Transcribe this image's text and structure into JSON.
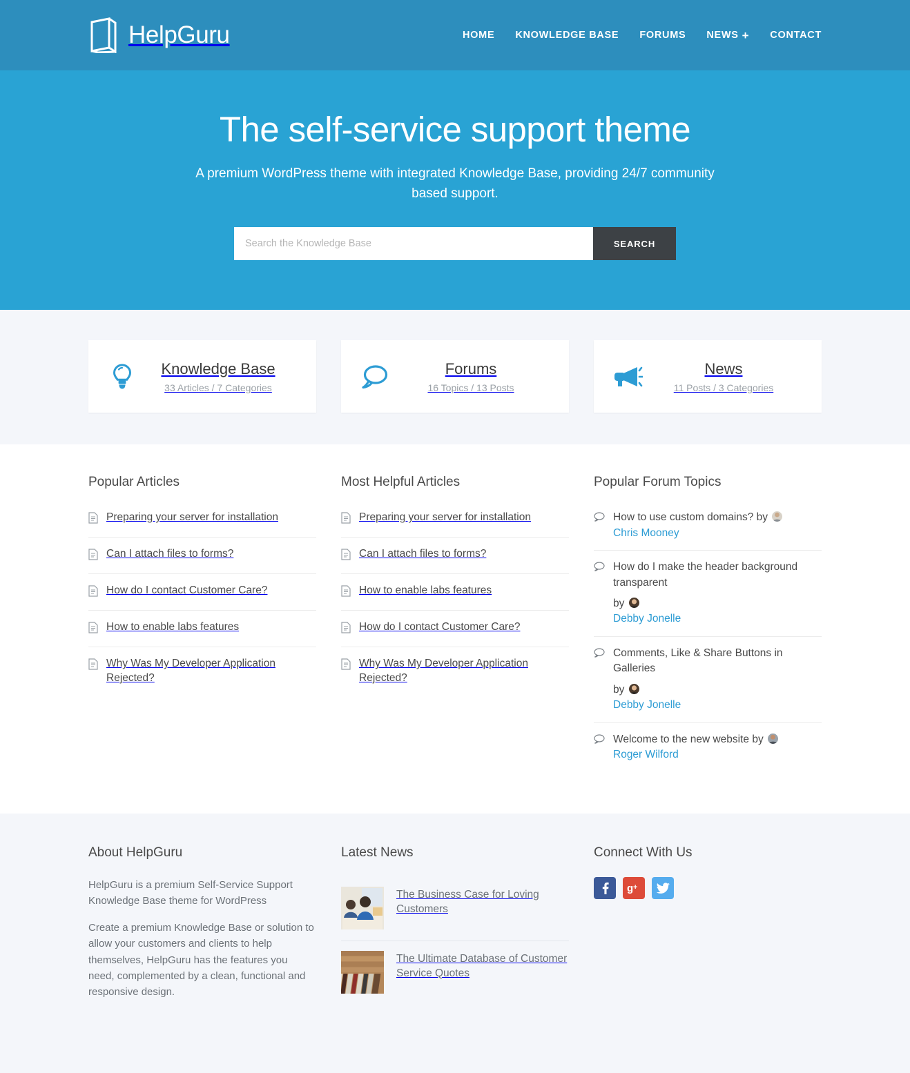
{
  "header": {
    "brand": "HelpGuru",
    "brand_icon": "book-icon",
    "bg_color": "#2d8ebd",
    "nav": [
      {
        "label": "HOME",
        "has_plus": false
      },
      {
        "label": "KNOWLEDGE BASE",
        "has_plus": false
      },
      {
        "label": "FORUMS",
        "has_plus": false
      },
      {
        "label": "NEWS",
        "has_plus": true,
        "plus": "+"
      },
      {
        "label": "CONTACT",
        "has_plus": false
      }
    ]
  },
  "hero": {
    "title": "The self-service support theme",
    "subtitle": "A premium WordPress theme with integrated Knowledge Base, providing 24/7 community based support.",
    "bg_color": "#29a3d4",
    "search": {
      "placeholder": "Search the Knowledge Base",
      "value": "",
      "button_label": "SEARCH",
      "button_color": "#3d4145"
    }
  },
  "cards": [
    {
      "icon": "lightbulb-icon",
      "title": "Knowledge Base",
      "meta": "33 Articles / 7 Categories"
    },
    {
      "icon": "speech-bubble-icon",
      "title": "Forums",
      "meta": "16 Topics / 13 Posts"
    },
    {
      "icon": "megaphone-icon",
      "title": "News",
      "meta": "11 Posts / 3 Categories"
    }
  ],
  "popular_articles": {
    "heading": "Popular Articles",
    "items": [
      "Preparing your server for installation",
      "Can I attach files to forms?",
      "How do I contact Customer Care?",
      "How to enable labs features",
      "Why Was My Developer Application Rejected?"
    ]
  },
  "most_helpful_articles": {
    "heading": "Most Helpful Articles",
    "items": [
      "Preparing your server for installation",
      "Can I attach files to forms?",
      "How to enable labs features",
      "How do I contact Customer Care?",
      "Why Was My Developer Application Rejected?"
    ]
  },
  "forum_topics": {
    "heading": "Popular Forum Topics",
    "by_label": "by",
    "items": [
      {
        "title": "How to use custom domains?",
        "author": "Chris Mooney",
        "inline_by": true
      },
      {
        "title": "How do I make the header background transparent",
        "author": "Debby Jonelle",
        "inline_by": false
      },
      {
        "title": "Comments, Like & Share Buttons in Galleries",
        "author": "Debby Jonelle",
        "inline_by": false
      },
      {
        "title": "Welcome to the new website",
        "author": "Roger Wilford",
        "inline_by": true
      }
    ],
    "link_color": "#2d9cd4"
  },
  "footer": {
    "about": {
      "heading": "About HelpGuru",
      "paragraphs": [
        "HelpGuru is a premium Self-Service Support Knowledge Base theme for WordPress",
        "Create a premium Knowledge Base or solution to allow your customers and clients to help themselves, HelpGuru has the features you need, complemented by a clean, functional and responsive design."
      ]
    },
    "latest_news": {
      "heading": "Latest News",
      "items": [
        {
          "title": "The Business Case for Loving Customers",
          "thumb": "office-meeting-photo"
        },
        {
          "title": "The Ultimate Database of Customer Service Quotes",
          "thumb": "books-on-wood-photo"
        }
      ]
    },
    "connect": {
      "heading": "Connect With Us",
      "socials": [
        {
          "name": "facebook-icon",
          "glyph": "f",
          "color": "#3b5998"
        },
        {
          "name": "google-plus-icon",
          "glyph": "g+",
          "color": "#dd4b39"
        },
        {
          "name": "twitter-icon",
          "glyph": "t",
          "color": "#55acee"
        }
      ]
    },
    "bg_color": "#f4f6fa"
  }
}
